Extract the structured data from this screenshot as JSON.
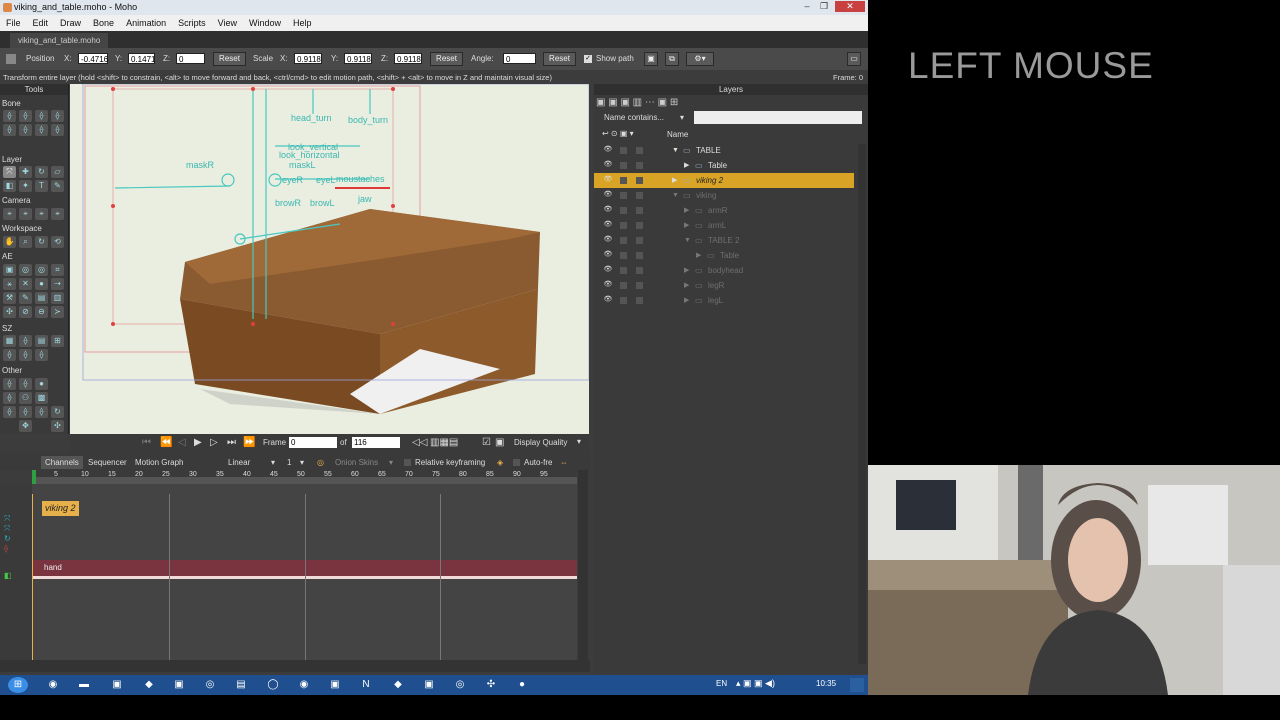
{
  "window": {
    "title": "viking_and_table.moho - Moho",
    "controls": [
      "–",
      "❐",
      "✕"
    ]
  },
  "menu": [
    "File",
    "Edit",
    "Draw",
    "Bone",
    "Animation",
    "Scripts",
    "View",
    "Window",
    "Help"
  ],
  "doc_tab": "viking_and_table.moho",
  "tool_options": {
    "position_label": "Position",
    "x_label": "X:",
    "x_value": "-0.4716",
    "y_label": "Y:",
    "y_value": "0.1471",
    "z_label": "Z:",
    "z_value": "0",
    "reset": "Reset",
    "scale_label": "Scale",
    "sx_label": "X:",
    "sx_value": "0.9118",
    "sy_label": "Y:",
    "sy_value": "0.9118",
    "sz_label": "Z:",
    "sz_value": "0.9118",
    "angle_label": "Angle:",
    "angle_value": "0",
    "show_path": "Show path"
  },
  "status_text": "Transform entire layer (hold <shift> to constrain, <alt> to move forward and back, <ctrl/cmd> to edit motion path, <shift> + <alt> to move in Z and maintain visual size)",
  "frame_indicator": "Frame: 0",
  "tools": {
    "title": "Tools",
    "sections": [
      "Bone",
      "Layer",
      "Camera",
      "Workspace",
      "AE",
      "SZ",
      "Other"
    ]
  },
  "canvas_labels": [
    "head_turn",
    "body_turn",
    "look_vertical",
    "look_horizontal",
    "maskR",
    "maskL",
    "eyeR",
    "eyeL",
    "moustaches",
    "browR",
    "browL",
    "jaw"
  ],
  "playbar": {
    "frame_label": "Frame",
    "frame_value": "0",
    "of_label": "of",
    "total_frames": "116",
    "display_quality": "Display Quality"
  },
  "timeline": {
    "tabs": [
      "Channels",
      "Sequencer",
      "Motion Graph"
    ],
    "interp": "Linear",
    "step": "1",
    "onion_skins": "Onion Skins",
    "relative_keyframing": "Relative keyframing",
    "auto_freeze": "Auto-fre",
    "ruler_ticks": [
      "5",
      "10",
      "15",
      "20",
      "25",
      "30",
      "35",
      "40",
      "45",
      "50",
      "55",
      "60",
      "65",
      "70",
      "75",
      "80",
      "85",
      "90",
      "95"
    ],
    "layer_label": "viking 2",
    "track_label": "hand"
  },
  "layers": {
    "title": "Layers",
    "filter_label": "Name contains...",
    "name_header": "Name",
    "rows": [
      {
        "name": "TABLE",
        "indent": 0,
        "dim": false,
        "selected": false,
        "expanded": true
      },
      {
        "name": "Table",
        "indent": 1,
        "dim": false,
        "selected": false,
        "expanded": false
      },
      {
        "name": "viking 2",
        "indent": 0,
        "dim": false,
        "selected": true,
        "expanded": false
      },
      {
        "name": "viking",
        "indent": 0,
        "dim": true,
        "selected": false,
        "expanded": true
      },
      {
        "name": "armR",
        "indent": 1,
        "dim": true,
        "selected": false,
        "expanded": false
      },
      {
        "name": "armL",
        "indent": 1,
        "dim": true,
        "selected": false,
        "expanded": false
      },
      {
        "name": "TABLE 2",
        "indent": 1,
        "dim": true,
        "selected": false,
        "expanded": true
      },
      {
        "name": "Table",
        "indent": 2,
        "dim": true,
        "selected": false,
        "expanded": false
      },
      {
        "name": "bodyhead",
        "indent": 1,
        "dim": true,
        "selected": false,
        "expanded": false
      },
      {
        "name": "legR",
        "indent": 1,
        "dim": true,
        "selected": false,
        "expanded": false
      },
      {
        "name": "legL",
        "indent": 1,
        "dim": true,
        "selected": false,
        "expanded": false
      }
    ]
  },
  "taskbar": {
    "lang": "EN",
    "clock": "10:35"
  },
  "overlay_text": "LEFT MOUSE",
  "colors": {
    "accent": "#e8b04a",
    "selected_row": "#d9a425",
    "track_red": "#7a3440",
    "bone": "#48c8c0",
    "table_wood": "#8a5a30"
  }
}
